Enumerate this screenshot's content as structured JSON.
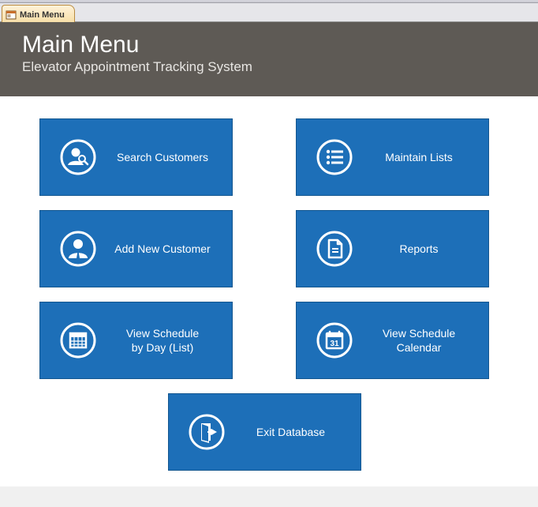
{
  "tab": {
    "label": "Main Menu"
  },
  "header": {
    "title": "Main Menu",
    "subtitle": "Elevator Appointment Tracking System"
  },
  "tiles": {
    "search_customers": "Search Customers",
    "maintain_lists": "Maintain Lists",
    "add_customer": "Add New Customer",
    "reports": "Reports",
    "schedule_day": "View Schedule\nby Day (List)",
    "schedule_calendar": "View Schedule\nCalendar",
    "exit_db": "Exit Database"
  }
}
